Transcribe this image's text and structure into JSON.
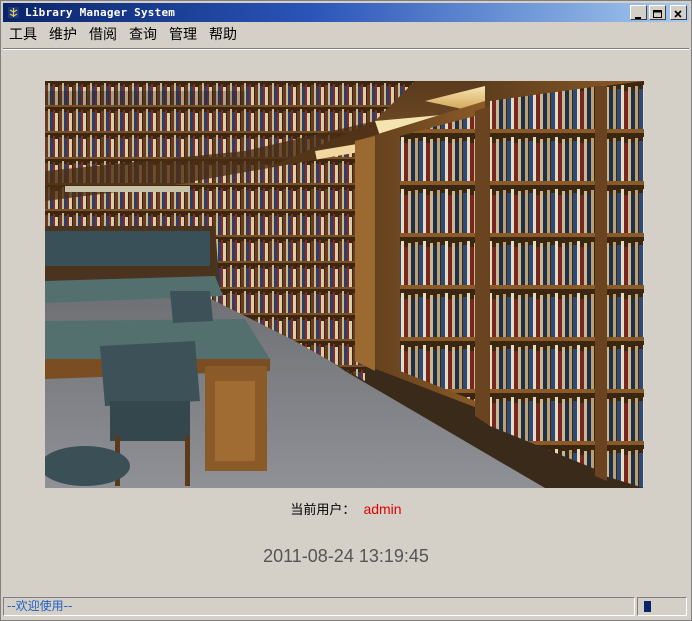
{
  "window": {
    "title": "Library Manager System",
    "controls": {
      "minimize": "minimize-icon",
      "maximize": "maximize-icon",
      "close": "close-icon"
    }
  },
  "menu": {
    "items": [
      {
        "label": "工具"
      },
      {
        "label": "维护"
      },
      {
        "label": "借阅"
      },
      {
        "label": "查询"
      },
      {
        "label": "管理"
      },
      {
        "label": "帮助"
      }
    ]
  },
  "main": {
    "image": "library-interior-photo",
    "user_label": "当前用户：",
    "user_name": "admin",
    "datetime": "2011-08-24 13:19:45"
  },
  "status": {
    "text": "--欢迎使用--",
    "progress": 0.15
  },
  "colors": {
    "title_start": "#0a246a",
    "title_end": "#a6caf0",
    "user_name": "#e00000",
    "status_text": "#2060c0",
    "background": "#d4d0c8"
  }
}
